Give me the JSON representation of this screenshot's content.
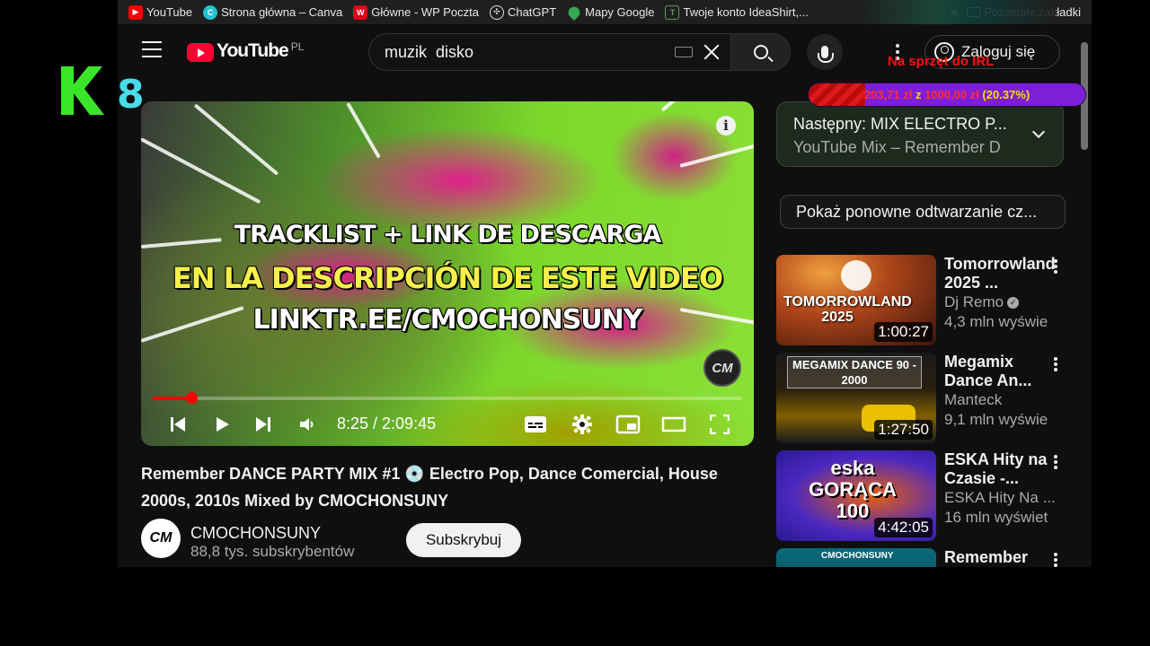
{
  "bookmarks": [
    {
      "label": "YouTube",
      "icon": "youtube-icon",
      "color": "#ff0000"
    },
    {
      "label": "Strona główna – Canva",
      "icon": "canva-icon",
      "color": "#20c4cb"
    },
    {
      "label": "Główne - WP Poczta",
      "icon": "wp-icon",
      "color": "#e0001a"
    },
    {
      "label": "ChatGPT",
      "icon": "chatgpt-icon",
      "color": "#ffffff"
    },
    {
      "label": "Mapy Google",
      "icon": "maps-pin-icon",
      "color": "#34a853"
    },
    {
      "label": "Twoje konto IdeaShirt,...",
      "icon": "shirt-icon",
      "color": "#5a9a5a"
    }
  ],
  "bookmarks_other": "Pozostałe zakładki",
  "header": {
    "logo_text": "YouTube",
    "country_code": "PL",
    "search_value": "muzik  disko",
    "signin_label": "Zaloguj się"
  },
  "player": {
    "overlay_line1": "TRACKLIST + LINK DE DESCARGA",
    "overlay_line2": "EN LA DESCRIPCIÓN DE ESTE VIDEO",
    "overlay_line3": "LINKTR.EE/CMOCHONSUNY",
    "watermark": "CM",
    "current_time": "8:25",
    "duration": "2:09:45",
    "time_display": "8:25 / 2:09:45",
    "progress": 0.065,
    "info_glyph": "i"
  },
  "video": {
    "title": "Remember DANCE PARTY MIX #1 💿 Electro Pop, Dance Comercial, House 2000s, 2010s Mixed by CMOCHONSUNY",
    "channel_name": "CMOCHONSUNY",
    "channel_avatar": "CM",
    "subscribers": "88,8 tys. subskrybentów",
    "subscribe_label": "Subskrybuj"
  },
  "sidebar": {
    "next_title": "Następny: MIX ELECTRO P...",
    "next_subtitle": "YouTube Mix – Remember D",
    "replay_chip": "Pokaż ponowne odtwarzanie cz...",
    "recommendations": [
      {
        "title": "Tomorrowland 2025 ...",
        "channel": "Dj Remo",
        "verified": true,
        "views": "4,3 mln wyświe",
        "duration": "1:00:27",
        "thumb_text": "TOMORROWLAND 2025"
      },
      {
        "title": "Megamix Dance An...",
        "channel": "Manteck",
        "verified": false,
        "views": "9,1 mln wyświe",
        "duration": "1:27:50",
        "thumb_text": "MEGAMIX DANCE 90 - 2000"
      },
      {
        "title": "ESKA Hity na Czasie -...",
        "channel": "ESKA Hity Na ...",
        "verified": false,
        "views": "16 mln wyświet",
        "duration": "4:42:05",
        "thumb_text": "eska GORĄCA 100"
      },
      {
        "title": "Remember",
        "channel": "",
        "verified": false,
        "views": "",
        "duration": "",
        "thumb_text": "CMOCHONSUNY"
      }
    ]
  },
  "overlay": {
    "k_number": "8",
    "goal_label": "Na sprzęt do IRL",
    "goal_current": "203,71 zł",
    "goal_of": "z",
    "goal_target": "1000,00 zł",
    "goal_percent": "(20.37%)",
    "goal_fraction": 0.2037
  },
  "colors": {
    "brand_red": "#ff0033",
    "background": "#0f0f0f",
    "goal_purple": "#7d1fd8",
    "k_green": "#3be62a",
    "k_cyan": "#49dde9"
  }
}
